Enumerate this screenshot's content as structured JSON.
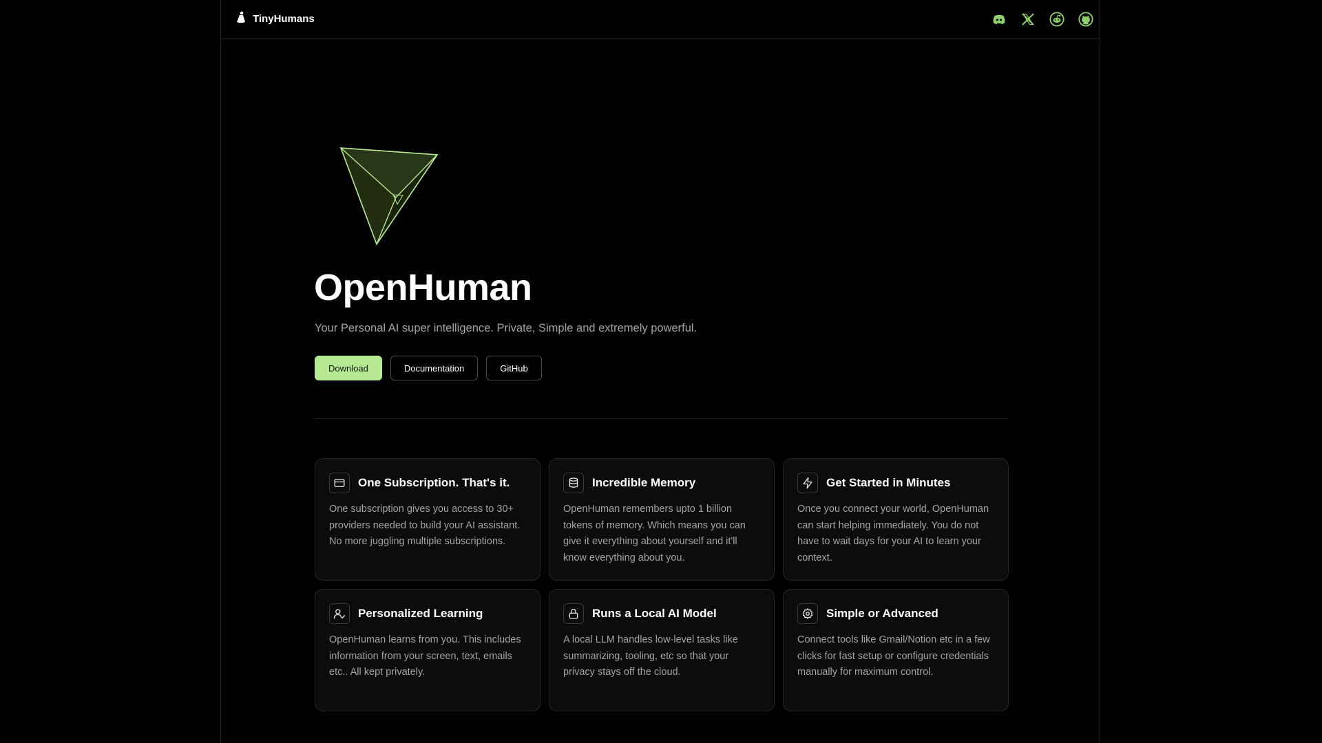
{
  "header": {
    "brand_name": "TinyHumans",
    "socials": [
      {
        "icon": "discord-icon"
      },
      {
        "icon": "x-icon"
      },
      {
        "icon": "reddit-icon"
      },
      {
        "icon": "github-icon"
      }
    ]
  },
  "hero": {
    "title": "OpenHuman",
    "subtitle": "Your Personal AI super intelligence. Private, Simple and extremely powerful.",
    "buttons": {
      "download": "Download",
      "documentation": "Documentation",
      "github": "GitHub"
    }
  },
  "features": [
    {
      "icon": "credit-card-icon",
      "title": "One Subscription. That's it.",
      "description": "One subscription gives you access to 30+ providers needed to build your AI assistant. No more juggling multiple subscriptions."
    },
    {
      "icon": "database-icon",
      "title": "Incredible Memory",
      "description": "OpenHuman remembers upto 1 billion tokens of memory. Which means you can give it everything about yourself and it'll know everything about you."
    },
    {
      "icon": "lightning-icon",
      "title": "Get Started in Minutes",
      "description": "Once you connect your world, OpenHuman can start helping immediately. You do not have to wait days for your AI to learn your context."
    },
    {
      "icon": "user-check-icon",
      "title": "Personalized Learning",
      "description": "OpenHuman learns from you. This includes information from your screen, text, emails etc.. All kept privately."
    },
    {
      "icon": "lock-icon",
      "title": "Runs a Local AI Model",
      "description": "A local LLM handles low-level tasks like summarizing, tooling, etc so that your privacy stays off the cloud."
    },
    {
      "icon": "settings-icon",
      "title": "Simple or Advanced",
      "description": "Connect tools like Gmail/Notion etc in a few clicks for fast setup or configure credentials manually for maximum control."
    }
  ],
  "colors": {
    "accent": "#b7e894",
    "social_icon": "#8fcf6e",
    "background": "#000000",
    "card_background": "#0c0c0c"
  }
}
